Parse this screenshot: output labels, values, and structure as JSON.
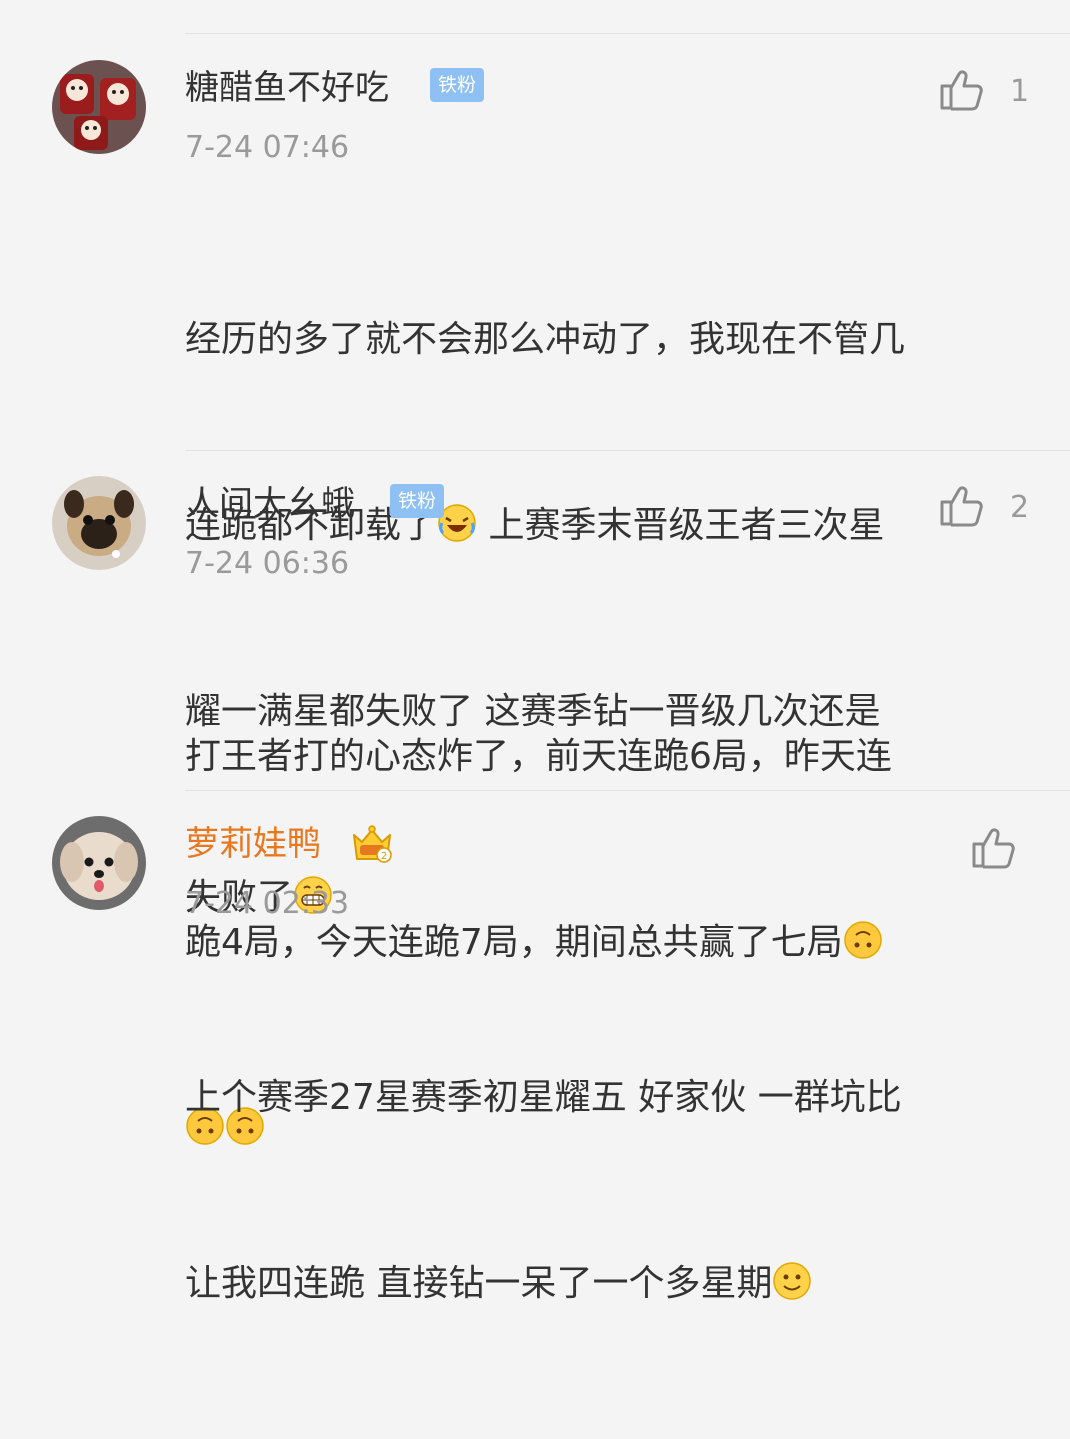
{
  "comments": [
    {
      "name": "糖醋鱼不好吃",
      "badge": "铁粉",
      "time": "7-24 07:46",
      "likes": "1",
      "lines": [
        "经历的多了就不会那么冲动了，我现在不管几",
        "连跪都不卸载了",
        "上赛季末晋级王者三次星",
        "耀一满星都失败了 这赛季钻一晋级几次还是",
        "失败了"
      ]
    },
    {
      "name": "人间大幺蛾",
      "badge": "铁粉",
      "time": "7-24 06:36",
      "likes": "2",
      "lines": [
        "打王者打的心态炸了，前天连跪6局，昨天连",
        "跪4局，今天连跪7局，期间总共赢了七局"
      ]
    },
    {
      "name": "萝莉娃鸭",
      "badge_level": "2",
      "time": "7-24 02:33",
      "likes": "",
      "lines": [
        "上个赛季27星赛季初星耀五 好家伙 一群坑比",
        "让我四连跪 直接钻一呆了一个多星期"
      ]
    }
  ],
  "icons": {
    "like": "thumbs-up-icon",
    "laugh_cry": "laughing-crying-emoji",
    "grin": "grinning-emoji",
    "upside_down": "upside-down-face-emoji",
    "smile": "slight-smile-emoji",
    "crown": "vip-crown-badge"
  },
  "colors": {
    "background": "#f4f4f4",
    "vip_name": "#e8771f",
    "badge_bg": "#8ec0f3",
    "meta_gray": "#9a9a9a"
  }
}
